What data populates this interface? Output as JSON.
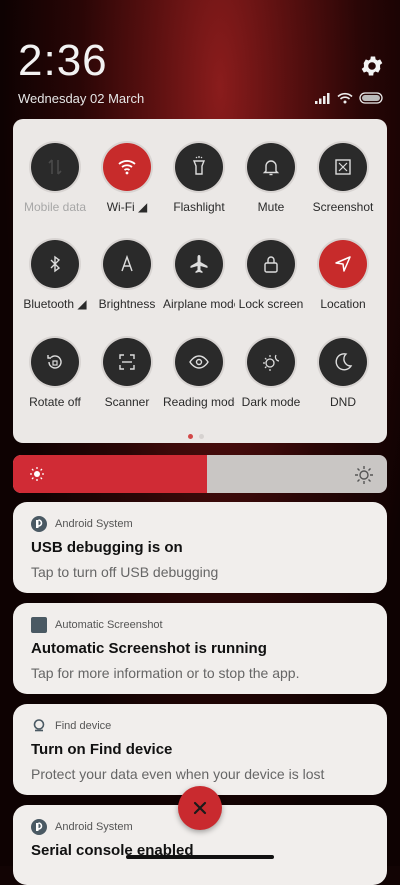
{
  "header": {
    "time": "2:36",
    "date": "Wednesday 02 March"
  },
  "quick_settings": [
    {
      "label": "Mobile data",
      "active": false,
      "dim": true,
      "icon": "mobile-data-icon"
    },
    {
      "label": "Wi-Fi ◢",
      "active": true,
      "dim": false,
      "icon": "wifi-icon"
    },
    {
      "label": "Flashlight",
      "active": false,
      "dim": false,
      "icon": "flashlight-icon"
    },
    {
      "label": "Mute",
      "active": false,
      "dim": false,
      "icon": "bell-icon"
    },
    {
      "label": "Screenshot",
      "active": false,
      "dim": false,
      "icon": "screenshot-icon"
    },
    {
      "label": "Bluetooth ◢",
      "active": false,
      "dim": false,
      "icon": "bluetooth-icon"
    },
    {
      "label": "Brightness",
      "active": false,
      "dim": false,
      "icon": "auto-brightness-icon"
    },
    {
      "label": "Airplane mode",
      "active": false,
      "dim": false,
      "icon": "airplane-icon"
    },
    {
      "label": "Lock screen",
      "active": false,
      "dim": false,
      "icon": "lock-icon"
    },
    {
      "label": "Location",
      "active": true,
      "dim": false,
      "icon": "location-icon"
    },
    {
      "label": "Rotate off",
      "active": false,
      "dim": false,
      "icon": "rotate-icon"
    },
    {
      "label": "Scanner",
      "active": false,
      "dim": false,
      "icon": "scanner-icon"
    },
    {
      "label": "Reading mode",
      "active": false,
      "dim": false,
      "icon": "eye-icon"
    },
    {
      "label": "Dark mode",
      "active": false,
      "dim": false,
      "icon": "dark-mode-icon"
    },
    {
      "label": "DND",
      "active": false,
      "dim": false,
      "icon": "moon-icon"
    }
  ],
  "brightness": {
    "level": 0.52
  },
  "notifications": [
    {
      "app": "Android System",
      "title": "USB debugging is on",
      "body": "Tap to turn off USB debugging",
      "icon": "android-system-icon"
    },
    {
      "app": "Automatic Screenshot",
      "title": "Automatic Screenshot is running",
      "body": "Tap for more information or to stop the app.",
      "icon": "app-square-icon"
    },
    {
      "app": "Find device",
      "title": "Turn on Find device",
      "body": "Protect your data even when your device is lost",
      "icon": "find-device-icon"
    },
    {
      "app": "Android System",
      "title": "Serial console enabled",
      "body": "",
      "icon": "android-system-icon"
    }
  ],
  "colors": {
    "accent": "#c72b2b",
    "panel": "#ebe8e6"
  }
}
